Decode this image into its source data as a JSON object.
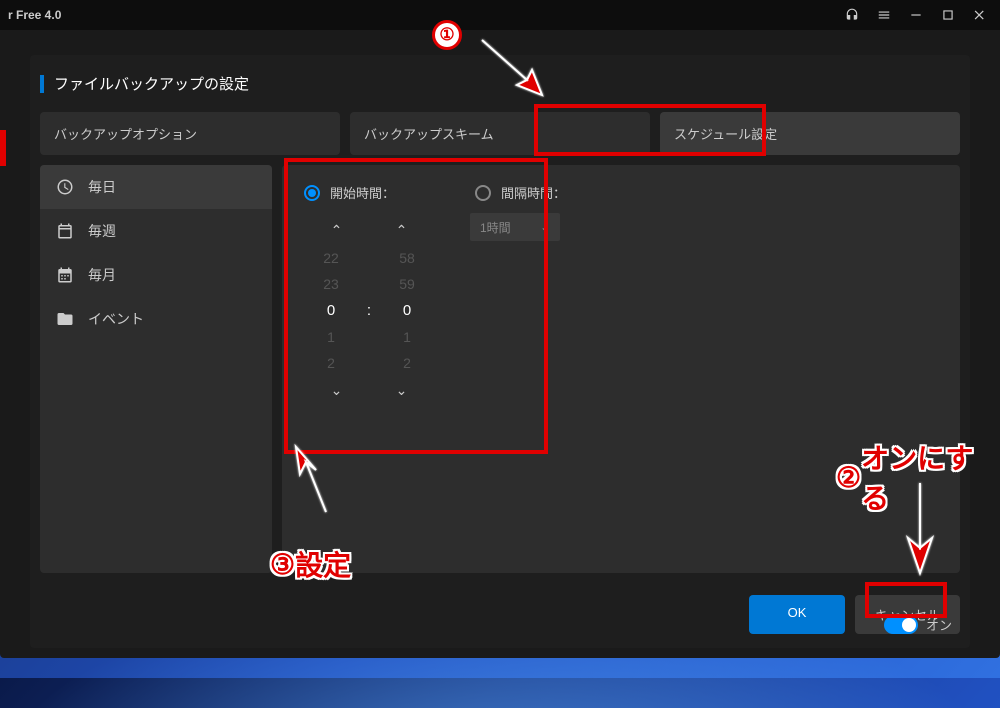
{
  "window": {
    "title": "r Free 4.0"
  },
  "dialog": {
    "title": "ファイルバックアップの設定"
  },
  "tabs": {
    "option": "バックアップオプション",
    "scheme": "バックアップスキーム",
    "schedule": "スケジュール設定"
  },
  "sidebar": {
    "items": [
      {
        "label": "毎日"
      },
      {
        "label": "毎週"
      },
      {
        "label": "毎月"
      },
      {
        "label": "イベント"
      }
    ]
  },
  "schedule": {
    "start_label": "開始時間：",
    "interval_label": "間隔時間：",
    "interval_value": "1時間",
    "hours": {
      "m2": "22",
      "m1": "23",
      "sel": "0",
      "p1": "1",
      "p2": "2"
    },
    "minutes": {
      "m2": "58",
      "m1": "59",
      "sel": "0",
      "p1": "1",
      "p2": "2"
    }
  },
  "toggle": {
    "label": "オン"
  },
  "buttons": {
    "ok": "OK",
    "cancel": "キャンセル"
  },
  "annotations": {
    "step1": "①",
    "step2_num": "②",
    "step2_text": "オンにする",
    "step3_num": "③",
    "step3_text": "設定"
  }
}
